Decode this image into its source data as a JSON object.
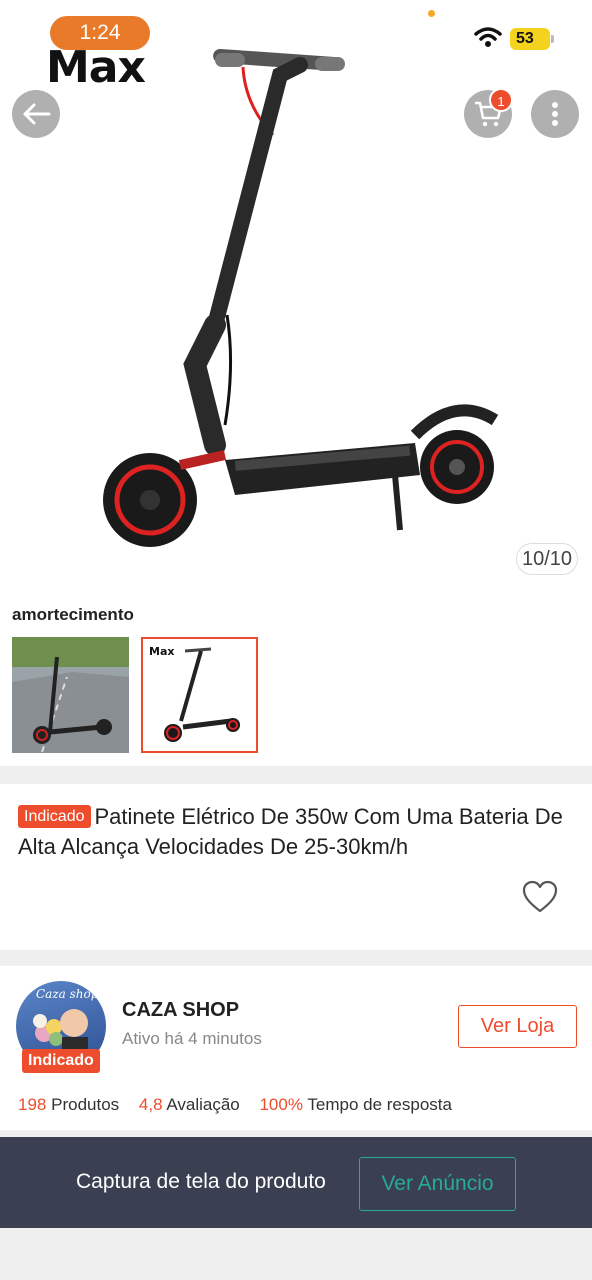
{
  "status_bar": {
    "time": "1:24",
    "battery": "53"
  },
  "brand": {
    "logo_text": "Max"
  },
  "header": {
    "cart_badge": "1"
  },
  "gallery": {
    "counter": "10/10"
  },
  "variation": {
    "label": "amortecimento",
    "selected_index": 1
  },
  "product": {
    "tag": "Indicado",
    "title": "Patinete Elétrico De 350w Com Uma Bateria De Alta Alcança Velocidades De 25-30km/h"
  },
  "shop": {
    "avatar_text": "Caza shop",
    "tag": "Indicado",
    "name": "CAZA SHOP",
    "status": "Ativo há 4 minutos",
    "button": "Ver Loja",
    "stats": [
      {
        "value": "198",
        "label": "Produtos"
      },
      {
        "value": "4,8",
        "label": "Avaliação"
      },
      {
        "value": "100%",
        "label": "Tempo de resposta"
      }
    ]
  },
  "bottom_bar": {
    "text": "Captura de tela do produto",
    "button": "Ver Anúncio"
  },
  "colors": {
    "accent": "#ee4d2d",
    "teal": "#26aa99",
    "bar": "#3b3f52"
  }
}
